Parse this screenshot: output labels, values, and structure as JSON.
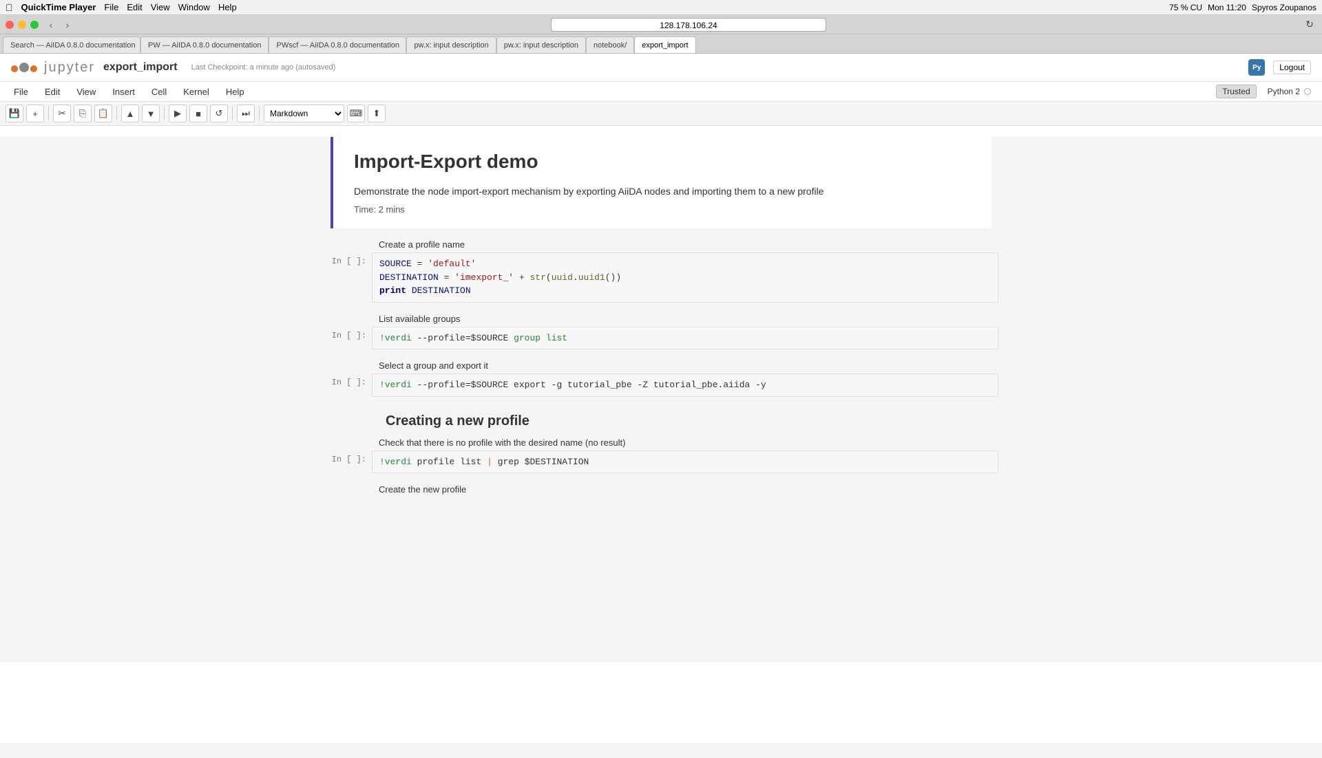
{
  "menubar": {
    "apple": "",
    "app": "QuickTime Player",
    "items": [
      "File",
      "Edit",
      "View",
      "Window",
      "Help"
    ],
    "right": {
      "cpu": "75 % CU",
      "datetime": "Mon 11:20",
      "user": "Spyros Zoupanos"
    }
  },
  "browser": {
    "address": "128.178.106.24",
    "tabs": [
      {
        "label": "Search — AiIDA 0.8.0 documentation",
        "active": false
      },
      {
        "label": "PW — AiIDA 0.8.0 documentation",
        "active": false
      },
      {
        "label": "PWscf — AiIDA 0.8.0 documentation",
        "active": false
      },
      {
        "label": "pw.x: input description",
        "active": false
      },
      {
        "label": "pw.x: input description",
        "active": false
      },
      {
        "label": "notebook/",
        "active": false
      },
      {
        "label": "export_import",
        "active": true
      }
    ]
  },
  "jupyter": {
    "logo_text": "jupyter",
    "notebook_name": "export_import",
    "checkpoint": "Last Checkpoint: a minute ago (autosaved)",
    "trusted": "Trusted",
    "kernel": "Python 2",
    "logout": "Logout",
    "menu": [
      "File",
      "Edit",
      "View",
      "Insert",
      "Cell",
      "Kernel",
      "Help"
    ],
    "toolbar": {
      "cell_type": "Markdown"
    }
  },
  "notebook": {
    "intro": {
      "title": "Import-Export demo",
      "description": "Demonstrate the node import-export mechanism by exporting AiiDA nodes and importing them to a new profile",
      "time": "Time: 2 mins"
    },
    "cells": [
      {
        "type": "markdown",
        "label": "Create a profile name"
      },
      {
        "type": "code",
        "prompt": "In [ ]:",
        "lines": [
          "SOURCE = 'default'",
          "DESTINATION = 'imexport_' + str(uuid.uuid1())",
          "print DESTINATION"
        ]
      },
      {
        "type": "markdown",
        "label": "List available groups"
      },
      {
        "type": "code",
        "prompt": "In [ ]:",
        "lines": [
          "!verdi --profile=$SOURCE group list"
        ]
      },
      {
        "type": "markdown",
        "label": "Select a group and export it"
      },
      {
        "type": "code",
        "prompt": "In [ ]:",
        "lines": [
          "!verdi --profile=$SOURCE export -g tutorial_pbe -Z tutorial_pbe.aiida -y"
        ]
      },
      {
        "type": "section",
        "heading": "Creating a new profile"
      },
      {
        "type": "markdown",
        "label": "Check that there is no profile with the desired name (no result)"
      },
      {
        "type": "code",
        "prompt": "In [ ]:",
        "lines": [
          "!verdi profile list | grep $DESTINATION"
        ]
      },
      {
        "type": "markdown",
        "label": "Create the new profile"
      }
    ]
  }
}
